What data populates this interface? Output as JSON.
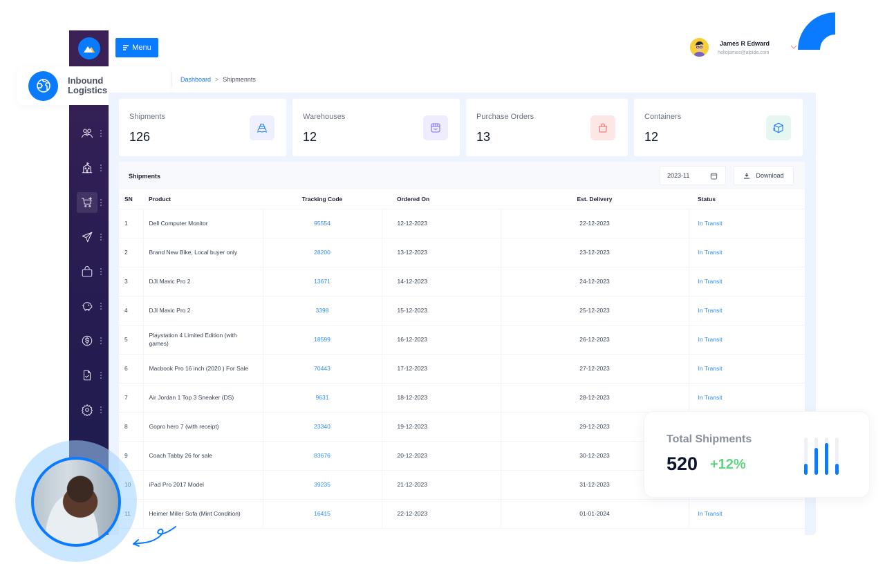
{
  "brand": {
    "name_line1": "Inbound",
    "name_line2": "Logistics",
    "logo_icon": "mountain-logo-icon",
    "globe_icon": "globe-icon"
  },
  "header": {
    "menu_label": "Menu",
    "user": {
      "name": "James R Edward",
      "email": "hellojames@alpide.com"
    }
  },
  "breadcrumb": {
    "parent": "Dashboard",
    "separator": ">",
    "current": "Shipmennts"
  },
  "sidebar": {
    "items": [
      {
        "icon": "users-icon",
        "active": false
      },
      {
        "icon": "building-icon",
        "active": false
      },
      {
        "icon": "cart-add-icon",
        "active": true
      },
      {
        "icon": "send-icon",
        "active": false
      },
      {
        "icon": "bag-icon",
        "active": false
      },
      {
        "icon": "piggy-bank-icon",
        "active": false
      },
      {
        "icon": "dollar-icon",
        "active": false
      },
      {
        "icon": "document-check-icon",
        "active": false
      },
      {
        "icon": "gear-icon",
        "active": false
      }
    ]
  },
  "stats": [
    {
      "label": "Shipments",
      "value": "126",
      "icon": "ship-icon",
      "color": "#1a73e8",
      "bg": "#eef0fd"
    },
    {
      "label": "Warehouses",
      "value": "12",
      "icon": "store-icon",
      "color": "#7b6cf0",
      "bg": "#efedfd"
    },
    {
      "label": "Purchase Orders",
      "value": "13",
      "icon": "shopping-bag-icon",
      "color": "#f0655a",
      "bg": "#fde6e6"
    },
    {
      "label": "Containers",
      "value": "12",
      "icon": "box-icon",
      "color": "#1a73e8",
      "bg": "#e6f7f1"
    }
  ],
  "table": {
    "title": "Shipments",
    "date_filter": "2023-11",
    "download_label": "Download",
    "columns": [
      "SN",
      "Product",
      "Tracking Code",
      "Ordered On",
      "Est. Delivery",
      "Status"
    ],
    "rows": [
      {
        "sn": "1",
        "product": "Dell Computer Monitor",
        "tracking": "95554",
        "ordered": "12-12-2023",
        "delivery": "22-12-2023",
        "status": "In Transit"
      },
      {
        "sn": "2",
        "product": "Brand New Bike, Local buyer only",
        "tracking": "28200",
        "ordered": "13-12-2023",
        "delivery": "23-12-2023",
        "status": "In Transit"
      },
      {
        "sn": "3",
        "product": "DJI Mavic Pro 2",
        "tracking": "13671",
        "ordered": "14-12-2023",
        "delivery": "24-12-2023",
        "status": "In Transit"
      },
      {
        "sn": "4",
        "product": "DJI Mavic Pro 2",
        "tracking": "3398",
        "ordered": "15-12-2023",
        "delivery": "25-12-2023",
        "status": "In Transit"
      },
      {
        "sn": "5",
        "product": "Playstation 4 Limited Edition (with games)",
        "tracking": "18599",
        "ordered": "16-12-2023",
        "delivery": "26-12-2023",
        "status": "In Transit"
      },
      {
        "sn": "6",
        "product": "Macbook Pro 16 inch (2020 ) For Sale",
        "tracking": "70443",
        "ordered": "17-12-2023",
        "delivery": "27-12-2023",
        "status": "In Transit"
      },
      {
        "sn": "7",
        "product": "Air Jordan 1 Top 3 Sneaker (DS)",
        "tracking": "9631",
        "ordered": "18-12-2023",
        "delivery": "28-12-2023",
        "status": "In Transit"
      },
      {
        "sn": "8",
        "product": "Gopro hero 7 (with receipt)",
        "tracking": "23340",
        "ordered": "19-12-2023",
        "delivery": "29-12-2023",
        "status": ""
      },
      {
        "sn": "9",
        "product": "Coach Tabby 26 for sale",
        "tracking": "83676",
        "ordered": "20-12-2023",
        "delivery": "30-12-2023",
        "status": ""
      },
      {
        "sn": "10",
        "product": "iPad Pro 2017 Model",
        "tracking": "39235",
        "ordered": "21-12-2023",
        "delivery": "31-12-2023",
        "status": ""
      },
      {
        "sn": "11",
        "product": "Heimer Miller Sofa (Mint Condition)",
        "tracking": "16415",
        "ordered": "22-12-2023",
        "delivery": "01-01-2024",
        "status": "In Transit"
      }
    ]
  },
  "total_card": {
    "label": "Total Shipments",
    "value": "520",
    "delta": "+12%",
    "delta_color": "#5fd67f",
    "bar_levels": [
      0.3,
      0.72,
      0.86,
      0.3
    ],
    "bar_color": "#0a7bff"
  },
  "colors": {
    "accent": "#0a7bff",
    "sidebar": "#2a1d52",
    "link": "#2e8cf0"
  }
}
